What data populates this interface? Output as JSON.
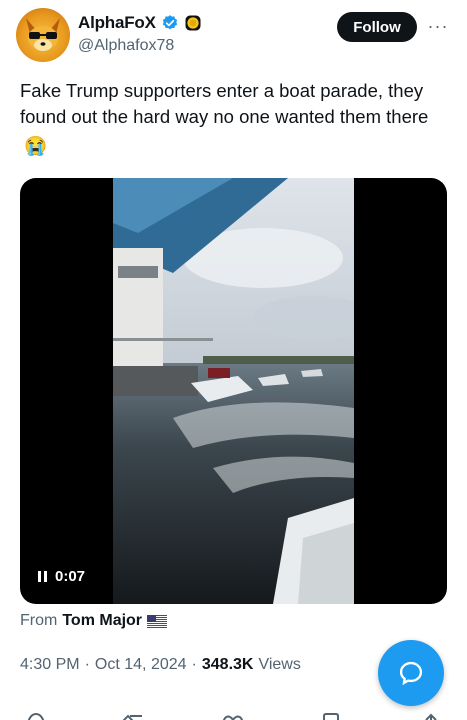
{
  "author": {
    "display_name": "AlphaFoX",
    "handle": "@Alphafox78",
    "verified": true,
    "accent_color": "#1d9bf0"
  },
  "actions": {
    "follow_label": "Follow",
    "more_label": "···"
  },
  "tweet": {
    "text": "Fake Trump supporters enter a boat parade, they found out the hard way no one wanted them there",
    "emoji": "😭"
  },
  "media": {
    "timestamp": "0:07",
    "state_icon": "pause-icon"
  },
  "attribution": {
    "from_label": "From",
    "from_name": "Tom Major",
    "flag": "us-flag-icon"
  },
  "meta": {
    "time": "4:30 PM",
    "separator": "·",
    "date": "Oct 14, 2024",
    "views_count": "348.3K",
    "views_label": "Views"
  },
  "fab": {
    "icon": "compose-reply-icon",
    "color": "#1d9bf0"
  }
}
